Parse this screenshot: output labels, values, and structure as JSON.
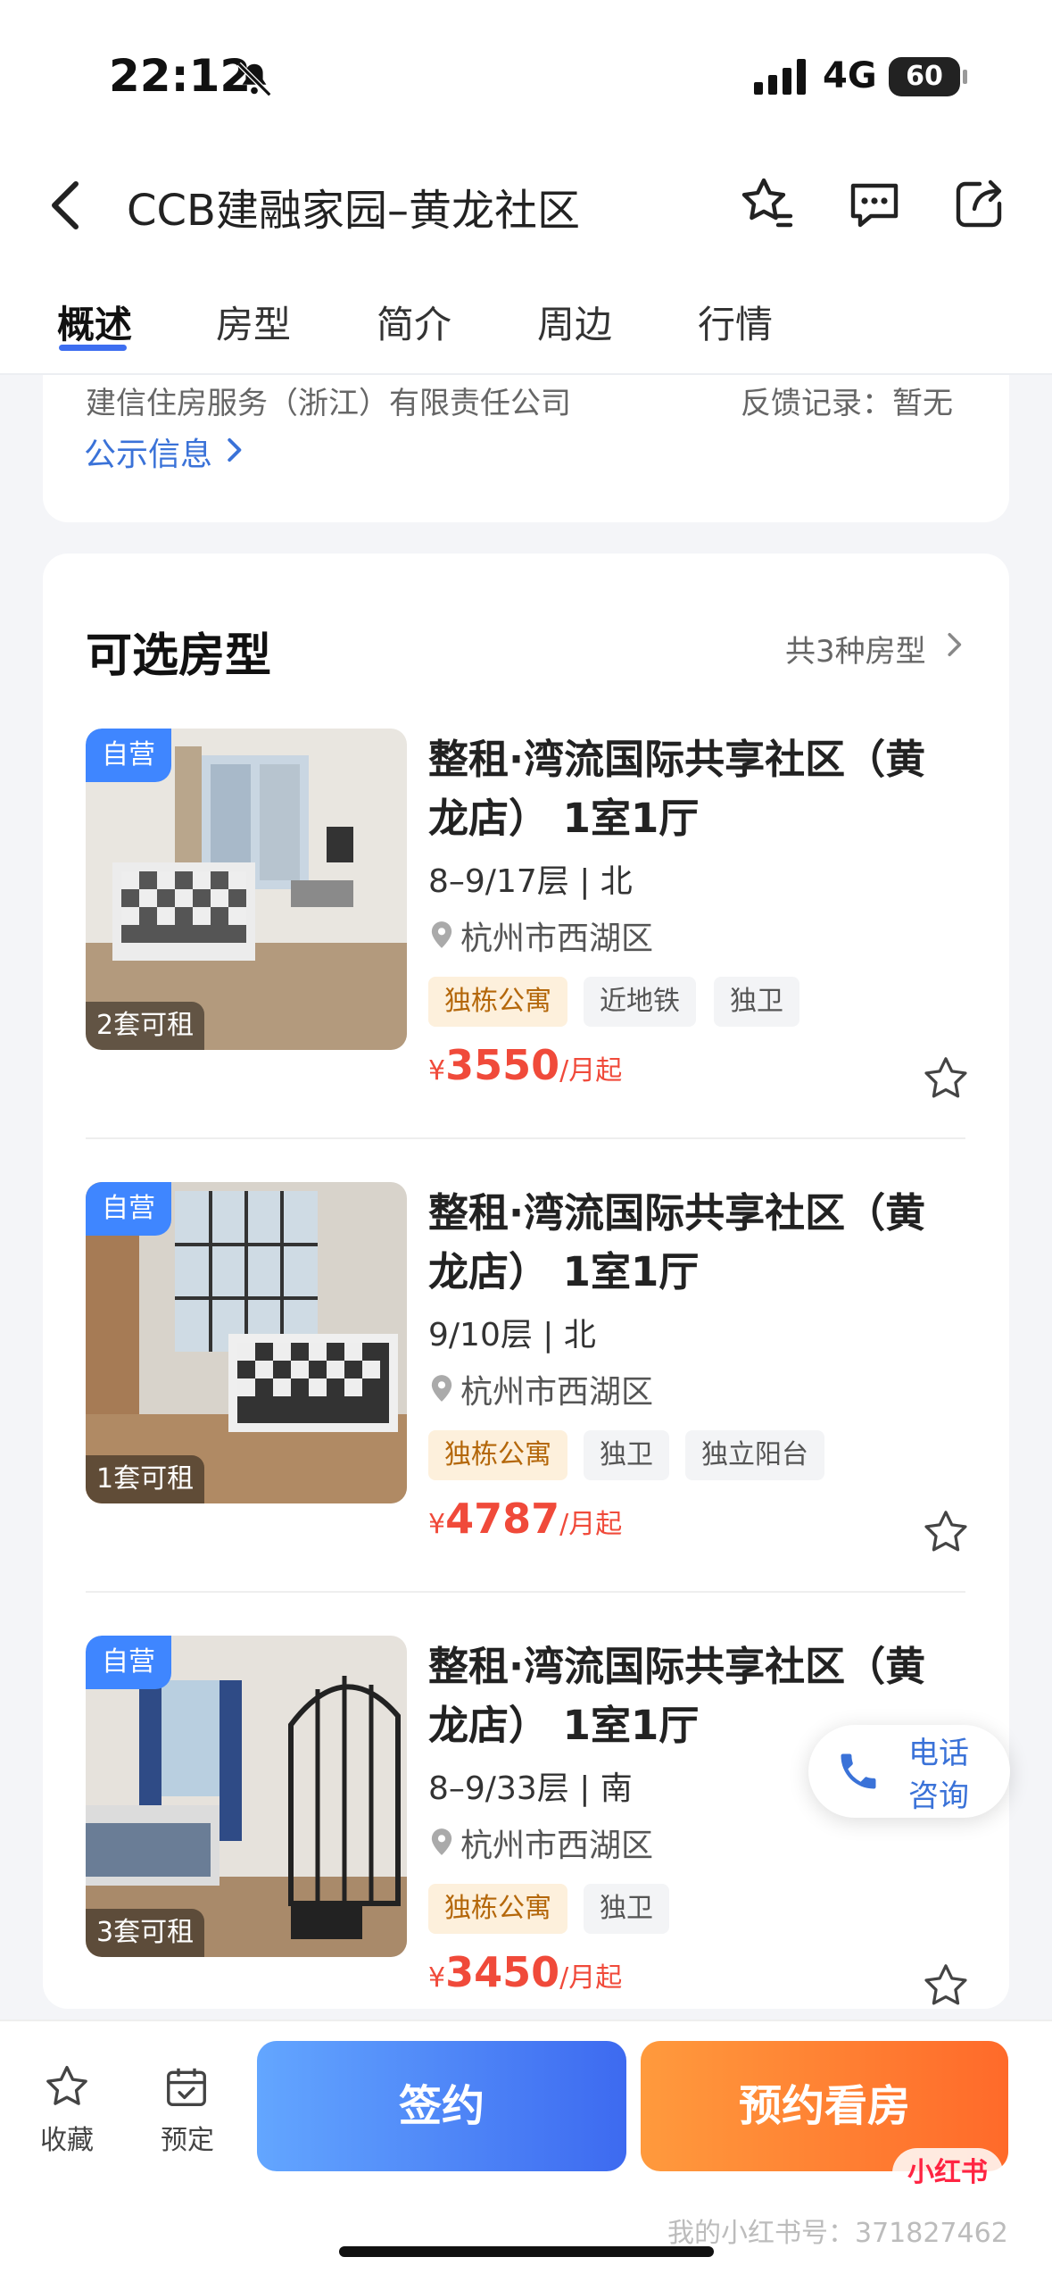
{
  "status_bar": {
    "time": "22:12",
    "network": "4G",
    "battery": "60"
  },
  "header": {
    "title": "CCB建融家园–黄龙社区"
  },
  "tabs": [
    {
      "label": "概述"
    },
    {
      "label": "房型"
    },
    {
      "label": "简介"
    },
    {
      "label": "周边"
    },
    {
      "label": "行情"
    }
  ],
  "info": {
    "company": "建信住房服务（浙江）有限责任公司",
    "feedback": "反馈记录：暂无",
    "public_link": "公示信息"
  },
  "rooms_section": {
    "title": "可选房型",
    "more": "共3种房型"
  },
  "rooms": [
    {
      "badge": "自营",
      "availability": "2套可租",
      "name": "整租·湾流国际共享社区（黄龙店） 1室1厅",
      "floor": "8–9/17层 | 北",
      "location": "杭州市西湖区",
      "tags": [
        "独栋公寓",
        "近地铁",
        "独卫"
      ],
      "price_symbol": "¥",
      "price": "3550",
      "price_unit": "/月起"
    },
    {
      "badge": "自营",
      "availability": "1套可租",
      "name": "整租·湾流国际共享社区（黄龙店） 1室1厅",
      "floor": "9/10层 | 北",
      "location": "杭州市西湖区",
      "tags": [
        "独栋公寓",
        "独卫",
        "独立阳台"
      ],
      "price_symbol": "¥",
      "price": "4787",
      "price_unit": "/月起"
    },
    {
      "badge": "自营",
      "availability": "3套可租",
      "name": "整租·湾流国际共享社区（黄龙店） 1室1厅",
      "floor": "8–9/33层 | 南",
      "location": "杭州市西湖区",
      "tags": [
        "独栋公寓",
        "独卫"
      ],
      "price_symbol": "¥",
      "price": "3450",
      "price_unit": "/月起"
    }
  ],
  "phone_float": {
    "line1": "电话",
    "line2": "咨询"
  },
  "bottom_bar": {
    "favorite": "收藏",
    "reserve": "预定",
    "sign": "签约",
    "book_viewing": "预约看房"
  },
  "watermark": {
    "logo": "小红书",
    "text": "我的小红书号：371827462"
  },
  "colors": {
    "accent": "#3d6ef0",
    "price": "#f04a3a",
    "link": "#3a72d8",
    "orange": "#ff7a30"
  }
}
